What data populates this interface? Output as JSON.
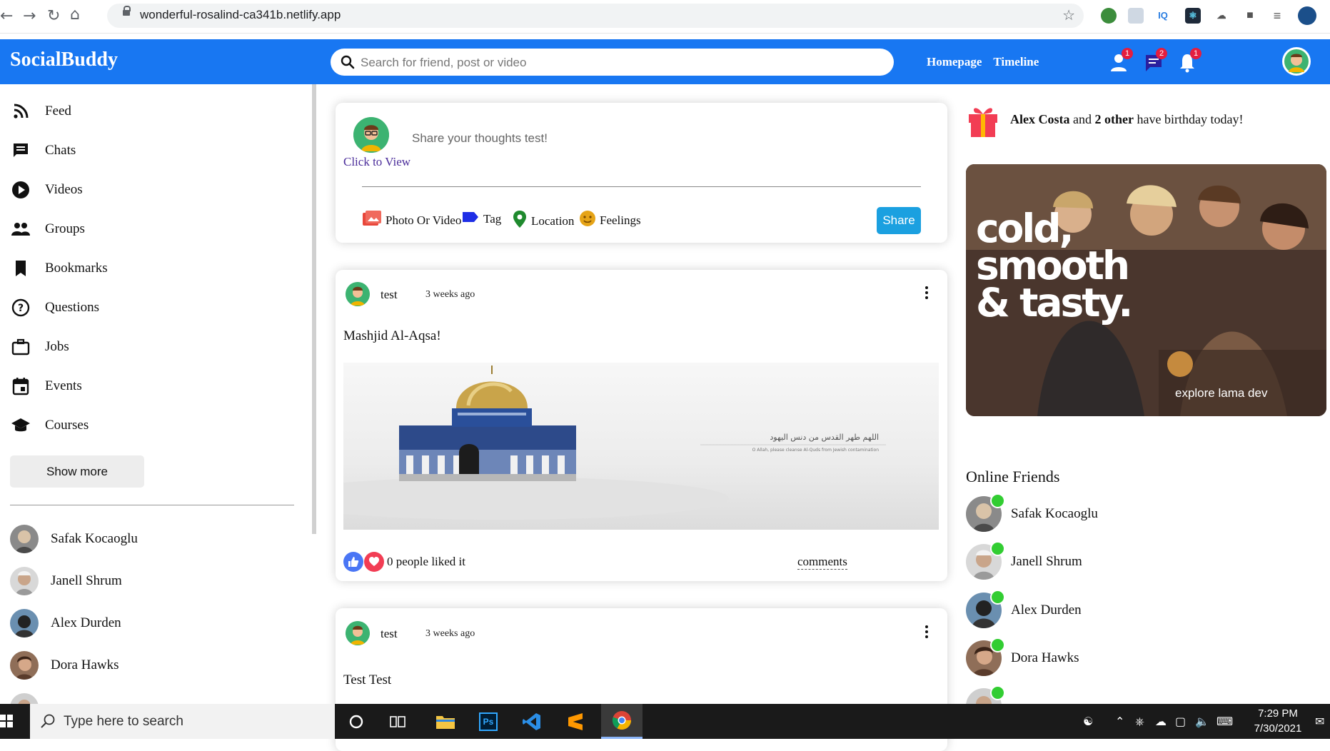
{
  "browser": {
    "url": "wonderful-rosalind-ca341b.netlify.app",
    "extensions": [
      "globe-ext-icon",
      "image-ext-icon",
      "iq-ext-icon",
      "react-ext-icon",
      "cloud-ext-icon",
      "puzzle-icon",
      "reading-list-icon",
      "profile-avatar"
    ],
    "iq_label": "IQ"
  },
  "header": {
    "logo": "SocialBuddy",
    "search_placeholder": "Search for friend, post or video",
    "links": [
      "Homepage",
      "Timeline"
    ],
    "badges": {
      "friends": "1",
      "messages": "2",
      "notifications": "1"
    },
    "brand_color": "#1877f2"
  },
  "sidebar": {
    "items": [
      {
        "label": "Feed",
        "icon": "rss-feed-icon"
      },
      {
        "label": "Chats",
        "icon": "chat-icon"
      },
      {
        "label": "Videos",
        "icon": "play-circle-icon"
      },
      {
        "label": "Groups",
        "icon": "group-icon"
      },
      {
        "label": "Bookmarks",
        "icon": "bookmark-icon"
      },
      {
        "label": "Questions",
        "icon": "help-icon"
      },
      {
        "label": "Jobs",
        "icon": "briefcase-icon"
      },
      {
        "label": "Events",
        "icon": "calendar-icon"
      },
      {
        "label": "Courses",
        "icon": "school-icon"
      }
    ],
    "show_more": "Show more",
    "friends": [
      "Safak Kocaoglu",
      "Janell Shrum",
      "Alex Durden",
      "Dora Hawks"
    ]
  },
  "share": {
    "placeholder": "Share your thoughts test!",
    "click_to_view": "Click to View",
    "options": [
      {
        "label": "Photo Or Video",
        "icon": "photo-icon",
        "color": "#e8473b"
      },
      {
        "label": "Tag",
        "icon": "label-icon",
        "color": "#1e2ee6"
      },
      {
        "label": "Location",
        "icon": "location-pin-icon",
        "color": "#1f8a2e"
      },
      {
        "label": "Feelings",
        "icon": "emoji-icon",
        "color": "#e6a417"
      }
    ],
    "button": "Share",
    "button_color": "#1ba0e0"
  },
  "posts": [
    {
      "user": "test",
      "time": "3 weeks ago",
      "text": "Mashjid Al-Aqsa!",
      "image_caption": "اللهم طهر القدس من دنس اليهود",
      "image_subcaption": "O Allah, please cleanse Al-Quds from Jewish contamination",
      "likes": "0 people liked it",
      "comments": "comments"
    },
    {
      "user": "test",
      "time": "3 weeks ago",
      "text": "Test Test"
    }
  ],
  "rightbar": {
    "birthday": {
      "name": "Alex Costa",
      "mid": " and ",
      "count": "2 other",
      "tail": " have birthday today!"
    },
    "ad": {
      "line1": "cold,",
      "line2": "smooth",
      "line3": "& tasty.",
      "sub": "explore lama dev"
    },
    "online_title": "Online Friends",
    "online": [
      "Safak Kocaoglu",
      "Janell Shrum",
      "Alex Durden",
      "Dora Hawks"
    ],
    "online_color": "#32cd32"
  },
  "taskbar": {
    "search": "Type here to search",
    "time": "7:29 PM",
    "date": "7/30/2021",
    "apps": [
      "cortana-icon",
      "task-view-icon",
      "file-explorer-icon",
      "photoshop-icon",
      "vscode-icon",
      "sublime-icon",
      "chrome-icon"
    ],
    "ps_label": "Ps"
  }
}
